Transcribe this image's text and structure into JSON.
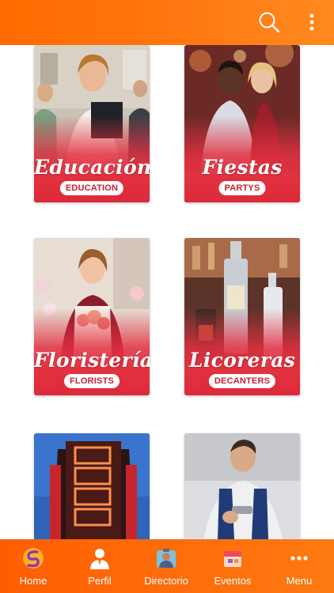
{
  "topbar": {
    "search_icon": "search-icon",
    "overflow_icon": "more-vertical-icon"
  },
  "categories": [
    {
      "title": "Educación",
      "tag": "EDUCATION"
    },
    {
      "title": "Fiestas",
      "tag": "PARTYS"
    },
    {
      "title": "Floristerías",
      "tag": "FLORISTS"
    },
    {
      "title": "Licoreras",
      "tag": "DECANTERS"
    },
    {
      "title": "",
      "tag": ""
    },
    {
      "title": "",
      "tag": ""
    }
  ],
  "bottom_nav": {
    "items": [
      {
        "label": "Home",
        "icon": "app-logo-icon"
      },
      {
        "label": "Perfil",
        "icon": "user-icon"
      },
      {
        "label": "Directorio",
        "icon": "directory-icon"
      },
      {
        "label": "Eventos",
        "icon": "events-icon"
      },
      {
        "label": "Menu",
        "icon": "more-horizontal-icon"
      }
    ]
  },
  "colors": {
    "brand_orange": "#ff6a00",
    "card_red": "#e2323f",
    "white": "#ffffff"
  }
}
